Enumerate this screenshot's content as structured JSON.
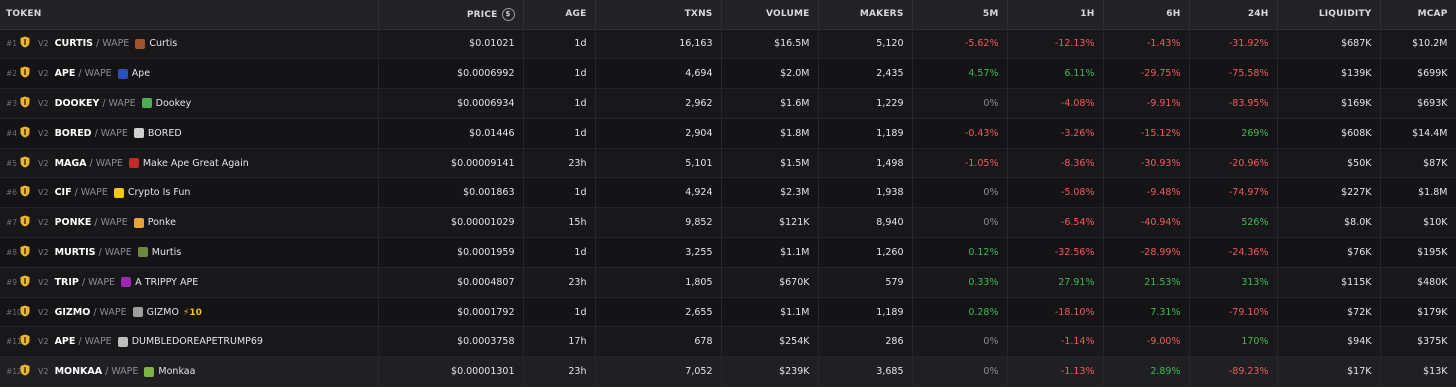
{
  "header": {
    "token": "TOKEN",
    "price": "PRICE",
    "age": "AGE",
    "txns": "TXNS",
    "volume": "VOLUME",
    "makers": "MAKERS",
    "m5": "5M",
    "h1": "1H",
    "h6": "6H",
    "h24": "24H",
    "liquidity": "LIQUIDITY",
    "mcap": "MCAP",
    "price_currency_icon": "dollar-circle-icon"
  },
  "colors": {
    "positive": "#3fb950",
    "negative": "#f05a5a",
    "neutral": "#8a8a93",
    "badge": "#f0b429"
  },
  "rows": [
    {
      "rank": "#1",
      "ver": "V2",
      "base": "CURTIS",
      "quote": "WAPE",
      "name": "Curtis",
      "boost": "",
      "avatar": "#a0522d",
      "price": "$0.01021",
      "age": "1d",
      "txns": "16,163",
      "volume": "$16.5M",
      "makers": "5,120",
      "m5": "-5.62%",
      "h1": "-12.13%",
      "h6": "-1.43%",
      "h24": "-31.92%",
      "liq": "$687K",
      "mcap": "$10.2M"
    },
    {
      "rank": "#2",
      "ver": "V2",
      "base": "APE",
      "quote": "WAPE",
      "name": "Ape",
      "boost": "",
      "avatar": "#2a52be",
      "price": "$0.0006992",
      "age": "1d",
      "txns": "4,694",
      "volume": "$2.0M",
      "makers": "2,435",
      "m5": "4.57%",
      "h1": "6.11%",
      "h6": "-29.75%",
      "h24": "-75.58%",
      "liq": "$139K",
      "mcap": "$699K"
    },
    {
      "rank": "#3",
      "ver": "V2",
      "base": "DOOKEY",
      "quote": "WAPE",
      "name": "Dookey",
      "boost": "",
      "avatar": "#4caf50",
      "price": "$0.0006934",
      "age": "1d",
      "txns": "2,962",
      "volume": "$1.6M",
      "makers": "1,229",
      "m5": "0%",
      "h1": "-4.08%",
      "h6": "-9.91%",
      "h24": "-83.95%",
      "liq": "$169K",
      "mcap": "$693K"
    },
    {
      "rank": "#4",
      "ver": "V2",
      "base": "BORED",
      "quote": "WAPE",
      "name": "BORED",
      "boost": "",
      "avatar": "#cfcfcf",
      "price": "$0.01446",
      "age": "1d",
      "txns": "2,904",
      "volume": "$1.8M",
      "makers": "1,189",
      "m5": "-0.43%",
      "h1": "-3.26%",
      "h6": "-15.12%",
      "h24": "269%",
      "liq": "$608K",
      "mcap": "$14.4M"
    },
    {
      "rank": "#5",
      "ver": "V2",
      "base": "MAGA",
      "quote": "WAPE",
      "name": "Make Ape Great Again",
      "boost": "",
      "avatar": "#c62828",
      "price": "$0.00009141",
      "age": "23h",
      "txns": "5,101",
      "volume": "$1.5M",
      "makers": "1,498",
      "m5": "-1.05%",
      "h1": "-8.36%",
      "h6": "-30.93%",
      "h24": "-20.96%",
      "liq": "$50K",
      "mcap": "$87K"
    },
    {
      "rank": "#6",
      "ver": "V2",
      "base": "CIF",
      "quote": "WAPE",
      "name": "Crypto Is Fun",
      "boost": "",
      "avatar": "#f5c518",
      "price": "$0.001863",
      "age": "1d",
      "txns": "4,924",
      "volume": "$2.3M",
      "makers": "1,938",
      "m5": "0%",
      "h1": "-5.08%",
      "h6": "-9.48%",
      "h24": "-74.97%",
      "liq": "$227K",
      "mcap": "$1.8M"
    },
    {
      "rank": "#7",
      "ver": "V2",
      "base": "PONKE",
      "quote": "WAPE",
      "name": "Ponke",
      "boost": "",
      "avatar": "#e8a33d",
      "price": "$0.00001029",
      "age": "15h",
      "txns": "9,852",
      "volume": "$121K",
      "makers": "8,940",
      "m5": "0%",
      "h1": "-6.54%",
      "h6": "-40.94%",
      "h24": "526%",
      "liq": "$8.0K",
      "mcap": "$10K"
    },
    {
      "rank": "#8",
      "ver": "V2",
      "base": "MURTIS",
      "quote": "WAPE",
      "name": "Murtis",
      "boost": "",
      "avatar": "#6d8a3c",
      "price": "$0.0001959",
      "age": "1d",
      "txns": "3,255",
      "volume": "$1.1M",
      "makers": "1,260",
      "m5": "0.12%",
      "h1": "-32.56%",
      "h6": "-28.99%",
      "h24": "-24.36%",
      "liq": "$76K",
      "mcap": "$195K"
    },
    {
      "rank": "#9",
      "ver": "V2",
      "base": "TRIP",
      "quote": "WAPE",
      "name": "A TRIPPY APE",
      "boost": "",
      "avatar": "#9c27b0",
      "price": "$0.0004807",
      "age": "23h",
      "txns": "1,805",
      "volume": "$670K",
      "makers": "579",
      "m5": "0.33%",
      "h1": "27.91%",
      "h6": "21.53%",
      "h24": "313%",
      "liq": "$115K",
      "mcap": "$480K"
    },
    {
      "rank": "#10",
      "ver": "V2",
      "base": "GIZMO",
      "quote": "WAPE",
      "name": "GIZMO",
      "boost": "⚡10",
      "avatar": "#9e9e9e",
      "price": "$0.0001792",
      "age": "1d",
      "txns": "2,655",
      "volume": "$1.1M",
      "makers": "1,189",
      "m5": "0.28%",
      "h1": "-18.10%",
      "h6": "7.31%",
      "h24": "-79.10%",
      "liq": "$72K",
      "mcap": "$179K"
    },
    {
      "rank": "#11",
      "ver": "V2",
      "base": "APE",
      "quote": "WAPE",
      "name": "DUMBLEDOREAPETRUMP69",
      "boost": "",
      "avatar": "#bdbdbd",
      "price": "$0.0003758",
      "age": "17h",
      "txns": "678",
      "volume": "$254K",
      "makers": "286",
      "m5": "0%",
      "h1": "-1.14%",
      "h6": "-9.00%",
      "h24": "170%",
      "liq": "$94K",
      "mcap": "$375K"
    },
    {
      "rank": "#12",
      "ver": "V2",
      "base": "MONKAA",
      "quote": "WAPE",
      "name": "Monkaa",
      "boost": "",
      "avatar": "#7cb342",
      "price": "$0.00001301",
      "age": "23h",
      "txns": "7,052",
      "volume": "$239K",
      "makers": "3,685",
      "m5": "0%",
      "h1": "-1.13%",
      "h6": "2.89%",
      "h24": "-89.23%",
      "liq": "$17K",
      "mcap": "$13K"
    }
  ]
}
